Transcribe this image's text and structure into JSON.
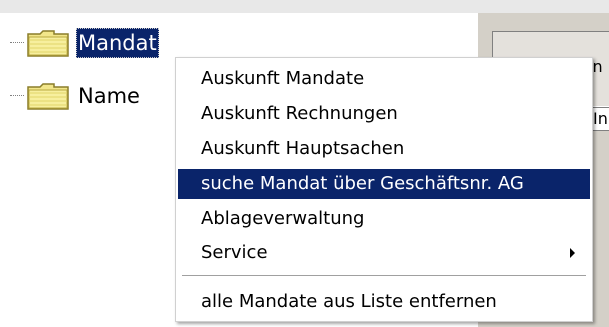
{
  "tree": {
    "items": [
      {
        "label": "Mandat",
        "selected": true,
        "icon": "folder-icon"
      },
      {
        "label": "Name",
        "selected": false,
        "icon": "folder-icon"
      }
    ]
  },
  "right_panel": {
    "text": "Van",
    "field": "In"
  },
  "context_menu": {
    "items": [
      {
        "label": "Auskunft Mandate",
        "highlighted": false
      },
      {
        "label": "Auskunft Rechnungen",
        "highlighted": false
      },
      {
        "label": "Auskunft Hauptsachen",
        "highlighted": false
      },
      {
        "label": "suche Mandat über Geschäftsnr. AG",
        "highlighted": true
      },
      {
        "label": "Ablageverwaltung",
        "highlighted": false
      },
      {
        "label": "Service",
        "highlighted": false,
        "has_submenu": true
      },
      {
        "label": "alle Mandate aus Liste entfernen",
        "highlighted": false
      }
    ]
  },
  "colors": {
    "highlight": "#0a246a",
    "highlight_text": "#ffffff",
    "folder_body": "#f2e68a",
    "folder_outline": "#8a7d2a",
    "panel_gray": "#d4d0c8"
  }
}
